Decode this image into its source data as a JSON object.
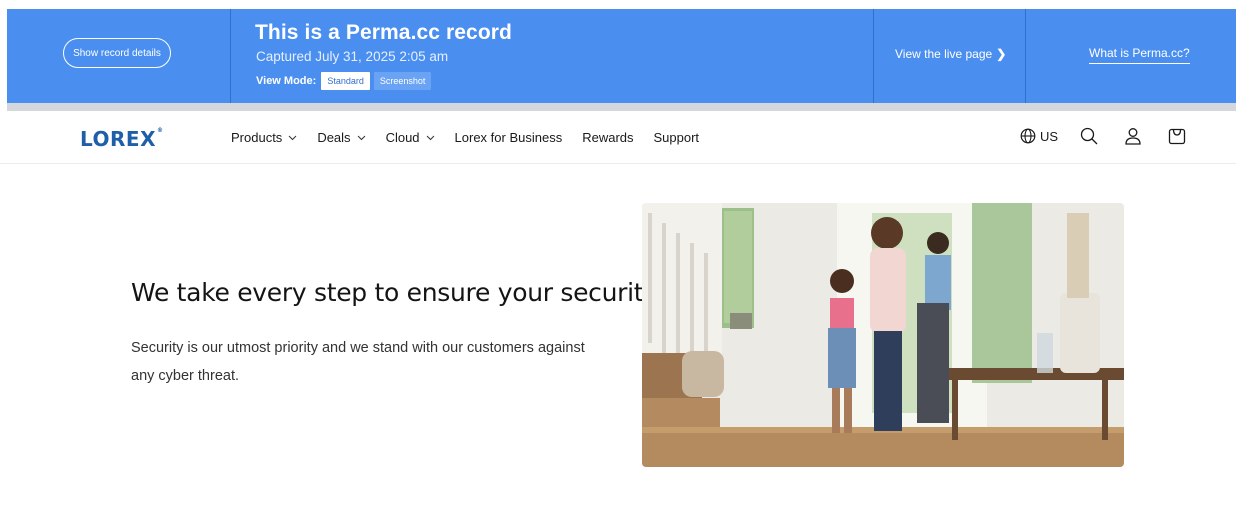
{
  "perma": {
    "details_button": "Show record details",
    "title": "This is a Perma.cc record",
    "captured": "Captured July 31, 2025 2:05 am",
    "view_mode_label": "View Mode:",
    "modes": [
      "Standard",
      "Screenshot"
    ],
    "active_mode": "Standard",
    "live_link": "View the live page",
    "live_link_icon": "chevron-right-icon",
    "what_link": "What is Perma.cc?",
    "colors": {
      "banner": "#4a8ff0",
      "strip": "#d4d8dd"
    }
  },
  "nav": {
    "logo": "LOREX",
    "logo_mark": "®",
    "menu": [
      {
        "label": "Products",
        "dropdown": true
      },
      {
        "label": "Deals",
        "dropdown": true
      },
      {
        "label": "Cloud",
        "dropdown": true
      },
      {
        "label": "Lorex for Business",
        "dropdown": false
      },
      {
        "label": "Rewards",
        "dropdown": false
      },
      {
        "label": "Support",
        "dropdown": false
      }
    ],
    "locale": "US",
    "icons": [
      "globe-icon",
      "search-icon",
      "account-icon",
      "cart-icon"
    ],
    "brand_color": "#1f5fa8"
  },
  "hero": {
    "title": "We take every step to ensure your security",
    "body": "Security is our utmost priority and we stand with our customers against any cyber threat.",
    "image": "photo-family-entering-home"
  }
}
